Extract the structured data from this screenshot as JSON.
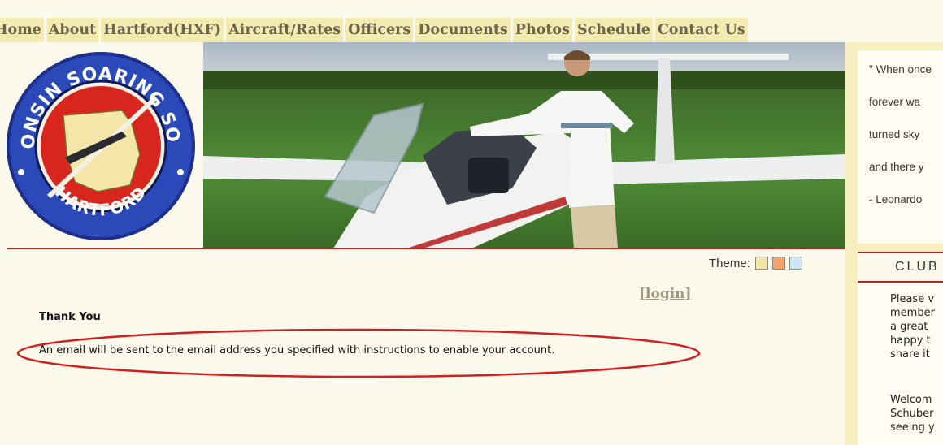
{
  "nav": {
    "tabs": [
      "Home",
      "About",
      "Hartford(HXF)",
      "Aircraft/Rates",
      "Officers",
      "Documents",
      "Photos",
      "Schedule",
      "Contact Us"
    ]
  },
  "logo": {
    "top_text": "WISCONSIN SOARING SOCIETY",
    "bottom_text": "HARTFORD"
  },
  "quote": {
    "lines": [
      "\" When once",
      "forever wa",
      "turned sky",
      "and there y",
      "- Leonardo"
    ]
  },
  "club": {
    "header": "CLUB",
    "paragraph1": [
      "Please v",
      "member",
      "a great",
      "happy t",
      "share it"
    ],
    "paragraph2": [
      "Welcom",
      "Schuber",
      "seeing y"
    ]
  },
  "theme": {
    "label": "Theme:",
    "swatches": [
      "#f2e6a6",
      "#f3a26c",
      "#cde6f5"
    ]
  },
  "login": {
    "label": "[login]"
  },
  "message": {
    "title": "Thank You",
    "body": "An email will be sent to the email address you specified with instructions to enable your account."
  },
  "colors": {
    "tab_bg": "#f4ebb0",
    "accent_red": "#c0221e",
    "page_bg": "#fbf8ec"
  }
}
